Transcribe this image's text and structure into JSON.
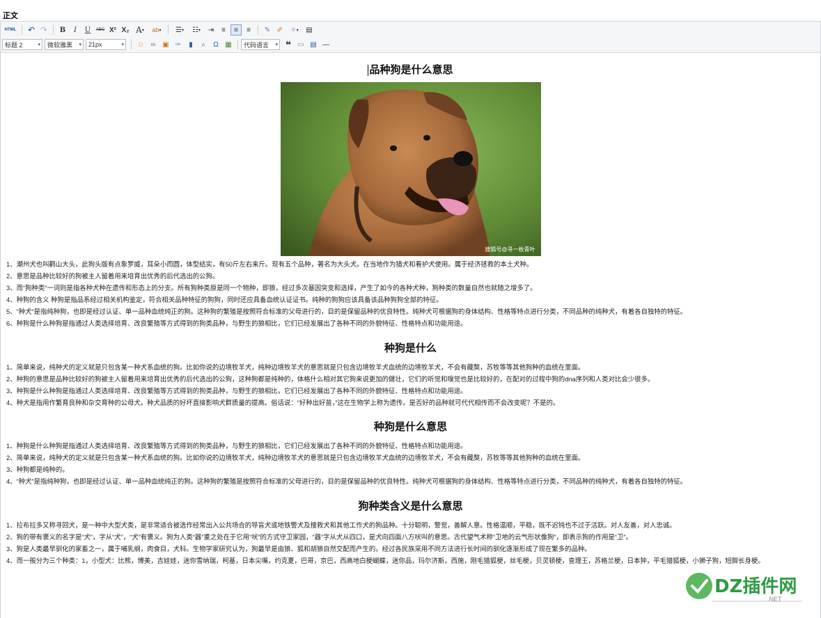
{
  "page": {
    "field_label": "正文"
  },
  "toolbar": {
    "html_label": "HTML",
    "bold": "B",
    "italic": "I",
    "underline": "U",
    "strike": "ABC",
    "superscript": "X²",
    "subscript": "X₂",
    "font_color": "A",
    "heading_value": "标题 2",
    "font_value": "微软雅黑",
    "size_value": "21px",
    "code_lang_value": "代码语言",
    "quote": "❝",
    "omega": "Ω"
  },
  "article": {
    "sections": [
      {
        "title": "品种狗是什么意思",
        "has_image": true,
        "image_watermark": "搜狐号@寻一枚青叶",
        "paragraphs": [
          "1、潮州犬也叫鹳山大头，此狗头版有点象罗威，耳朵小而圆，体型结实，有50斤左右来斤。现有五个品种，著名为大头犬。在当地作为猎犬和看护犬使用。属于经济拯救的本土犬种。",
          "2、意思是品种比较好的狗被主人留着用来培育出优秀的后代选出的公狗。",
          "3、而“狗种类”一词则是指各种犬种在遗传和形态上的分支。所有狗种类原是同一个物种，即狼，经过多次基因突变和选择，产生了如今的各种犬种，狗种类的数量自然也就随之增多了。",
          "4、种狗的含义 种狗是指品系经过相关机构鉴定，符合相关品种特征的狗狗，同时还应具备血统认证证书。纯种的狗狗应该具备该品种狗狗全部的特征。",
          "5、“种犬”是指纯种狗，也即是经过认证、单一品种血统纯正的狗。这种狗的繁殖是按照符合标准的父母进行的，目的是保留品种的优良特性。纯种犬可根据狗的身体结构、性格等特点进行分类，不同品种的纯种犬，有着各自独特的特征。",
          "6、种狗是什么种狗是指通过人类选择培育、改良繁殖等方式得到的狗类品种，与野生的狼相比，它们已经发展出了各种不同的外貌特征、性格特点和功能用途。"
        ]
      },
      {
        "title": "种狗是什么",
        "has_image": false,
        "paragraphs": [
          "1、简单来说，纯种犬的定义就是只包含某一种犬系血统的狗。比如你说的边境牧羊犬，纯种边境牧羊犬的意思就是只包含边境牧羊犬血统的边境牧羊犬，不会有藏獒，苏牧等等其他狗种的血统在里面。",
          "2、种狗的意思是品种比较好的狗被主人留着用来培育出优秀的后代选出的公狗，这种狗都是纯种的，体格什么相对其它狗来说更加的健壮，它们的听觉和嗅觉也是比较好的，在配对的过程中狗的dna序列和人类对比会少很多。",
          "3、种狗是什么种狗是指通过人类选择培育、改良繁殖等方式得到的狗类品种，与野生的狼相比，它们已经发展出了各种不同的外貌特征、性格特点和功能用途。",
          "4、种犬是指用作繁育良种和杂交育种的公母犬。种犬品质的好坏直接影响犬群质量的提高。俗话说：“好种出好苗，”这在生物学上称为遗传。是否好的品种就可代代相传而不会改变呢？不是的。"
        ]
      },
      {
        "title": "种狗是什么意思",
        "has_image": false,
        "paragraphs": [
          "1、种狗是什么种狗是指通过人类选择培育、改良繁殖等方式得到的狗类品种，与野生的狼相比，它们已经发展出了各种不同的外貌特征、性格特点和功能用途。",
          "2、简单来说，纯种犬的定义就是只包含某一种犬系血统的狗。比如你说的边境牧羊犬，纯种边境牧羊犬的意思就是只包含边境牧羊犬血统的边境牧羊犬，不会有藏獒，苏牧等等其他狗种的血统在里面。",
          "3、种狗都是纯种的。",
          "4、“种犬”是指纯种狗，也即是经过认证、单一品种血统纯正的狗。这种狗的繁殖是按照符合标准的父母进行的，目的是保留品种的优良特性。纯种犬可根据狗的身体结构、性格等特点进行分类，不同品种的纯种犬，有着各自独特的特征。"
        ]
      },
      {
        "title": "狗种类含义是什么意思",
        "has_image": false,
        "paragraphs": [
          "1、拉布拉多又称寻回犬，是一种中大型犬类，是非常适合被选作经常出入公共场合的导盲犬或地铁警犬及搜救犬和其他工作犬的狗品种。十分聪明，警觉，善解人意。性格温顺，平稳，既不迟钝也不过于活跃。对人友善，对人忠诚。",
          "2、狗的带有褒义的名字是“犬”，字从“犬”，“犬”有褒义。狗为人类“器”重之处在于它用“吠”的方式守卫家园，“器”字从犬从四口，是犬向四面八方吠叫的意思。古代望气术称“卫地的云气形状像狗”，即表示狗的作用是“卫”。",
          "3、狗是人类最早驯化的家畜之一，属于哺乳纲，肉食目，犬科。生物学家研究认为，狗最早是由狼、狐和胡狼自然交配而产生的。经过各民族采用不同方法进行长时间的驯化逐渐形成了现在繁多的品种。",
          "4、而一般分为三个种类：1，小型犬：比熊，博美，吉娃娃，迷你雪纳瑞，柯基，日本尖嘴，约克夏，巴哥，京巴，西高地白梗蝴蝶，迷你品，玛尔济斯，西施，刚毛猎狐梗，丝毛梗，贝灵顿梗，查理王，苏格兰梗，日本狆，平毛猎狐梗，小狮子狗，短脚长身梗。"
        ]
      }
    ]
  },
  "watermark": {
    "brand": "DZ插件网",
    "domain": ".NET",
    "brand_color": "#2e9b42"
  }
}
